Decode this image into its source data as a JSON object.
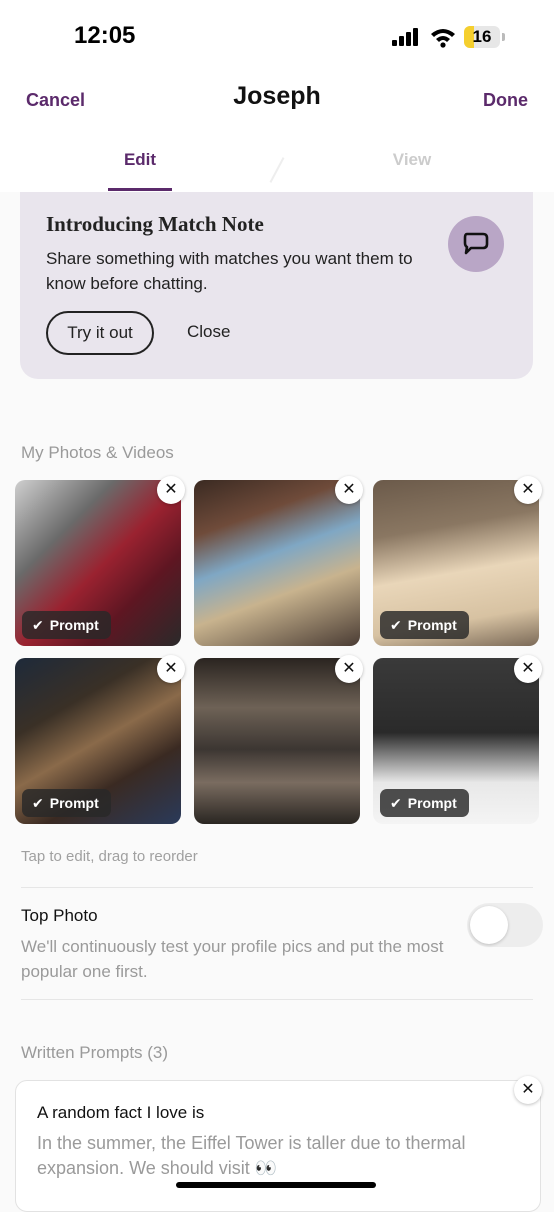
{
  "status_bar": {
    "time": "12:05",
    "battery": "16"
  },
  "header": {
    "cancel_label": "Cancel",
    "title": "Joseph",
    "done_label": "Done",
    "tabs": [
      {
        "label": "Edit",
        "active": true
      },
      {
        "label": "View",
        "active": false
      }
    ]
  },
  "banner": {
    "title": "Introducing Match Note",
    "body": "Share something with matches you want them to know before chatting.",
    "try_label": "Try it out",
    "close_label": "Close",
    "icon": "chat-bubble-icon"
  },
  "photos": {
    "section_label": "My Photos & Videos",
    "prompt_badge": "Prompt",
    "hint": "Tap to edit, drag to reorder"
  },
  "top_photo": {
    "title": "Top Photo",
    "description": "We'll continuously test your profile pics and put the most popular one first.",
    "enabled": false
  },
  "written_prompts": {
    "section_label": "Written Prompts (3)",
    "items": [
      {
        "question": "A random fact I love is",
        "answer": "In the summer, the Eiffel Tower is taller due to thermal expansion. We should visit 👀"
      }
    ]
  },
  "colors": {
    "accent": "#5b2a6b",
    "banner_bg": "#e9e5ed",
    "muted_text": "#9a9a9a"
  }
}
